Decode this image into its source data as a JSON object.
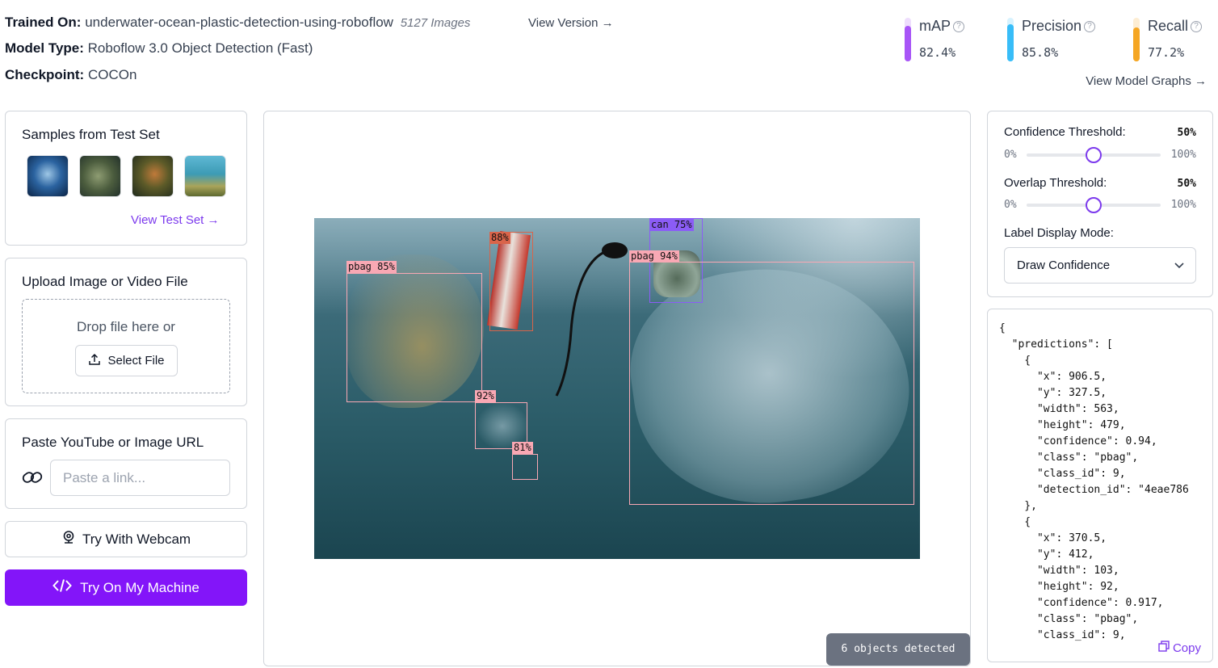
{
  "header": {
    "trained_on_label": "Trained On:",
    "trained_on_value": "underwater-ocean-plastic-detection-using-roboflow",
    "image_count": "5127 Images",
    "view_version": "View Version →",
    "model_type_label": "Model Type:",
    "model_type_value": "Roboflow 3.0 Object Detection (Fast)",
    "checkpoint_label": "Checkpoint:",
    "checkpoint_value": "COCOn",
    "view_model_graphs": "View Model Graphs →"
  },
  "metrics": [
    {
      "name": "mAP",
      "value": "82.4%",
      "fraction": 0.824,
      "color": "#a855f7"
    },
    {
      "name": "Precision",
      "value": "85.8%",
      "fraction": 0.858,
      "color": "#38bdf8"
    },
    {
      "name": "Recall",
      "value": "77.2%",
      "fraction": 0.772,
      "color": "#f5a623"
    }
  ],
  "samples": {
    "title": "Samples from Test Set",
    "view_test_set": "View Test Set →"
  },
  "upload": {
    "title": "Upload Image or Video File",
    "drop_text": "Drop file here or",
    "select_file": "Select File"
  },
  "url": {
    "title": "Paste YouTube or Image URL",
    "placeholder": "Paste a link..."
  },
  "webcam_button": "Try With Webcam",
  "machine_button": "Try On My Machine",
  "detections": [
    {
      "label": "pbag  85%",
      "color": "#f9a8b4"
    },
    {
      "label": "88%",
      "color": "#d9644a"
    },
    {
      "label": "can  75%",
      "color": "#8b5cf6"
    },
    {
      "label": "pbag  94%",
      "color": "#f9a8b4"
    },
    {
      "label": "92%",
      "color": "#f9a8b4"
    },
    {
      "label": "81%",
      "color": "#f9a8b4"
    }
  ],
  "objects_detected": "6 objects detected",
  "controls": {
    "confidence_label": "Confidence Threshold:",
    "confidence_value": "50%",
    "confidence_fraction": 0.5,
    "overlap_label": "Overlap Threshold:",
    "overlap_value": "50%",
    "overlap_fraction": 0.5,
    "min": "0%",
    "max": "100%",
    "label_mode_label": "Label Display Mode:",
    "label_mode_value": "Draw Confidence"
  },
  "json_output": "{\n  \"predictions\": [\n    {\n      \"x\": 906.5,\n      \"y\": 327.5,\n      \"width\": 563,\n      \"height\": 479,\n      \"confidence\": 0.94,\n      \"class\": \"pbag\",\n      \"class_id\": 9,\n      \"detection_id\": \"4eae786\n    },\n    {\n      \"x\": 370.5,\n      \"y\": 412,\n      \"width\": 103,\n      \"height\": 92,\n      \"confidence\": 0.917,\n      \"class\": \"pbag\",\n      \"class_id\": 9,",
  "copy_label": "Copy"
}
